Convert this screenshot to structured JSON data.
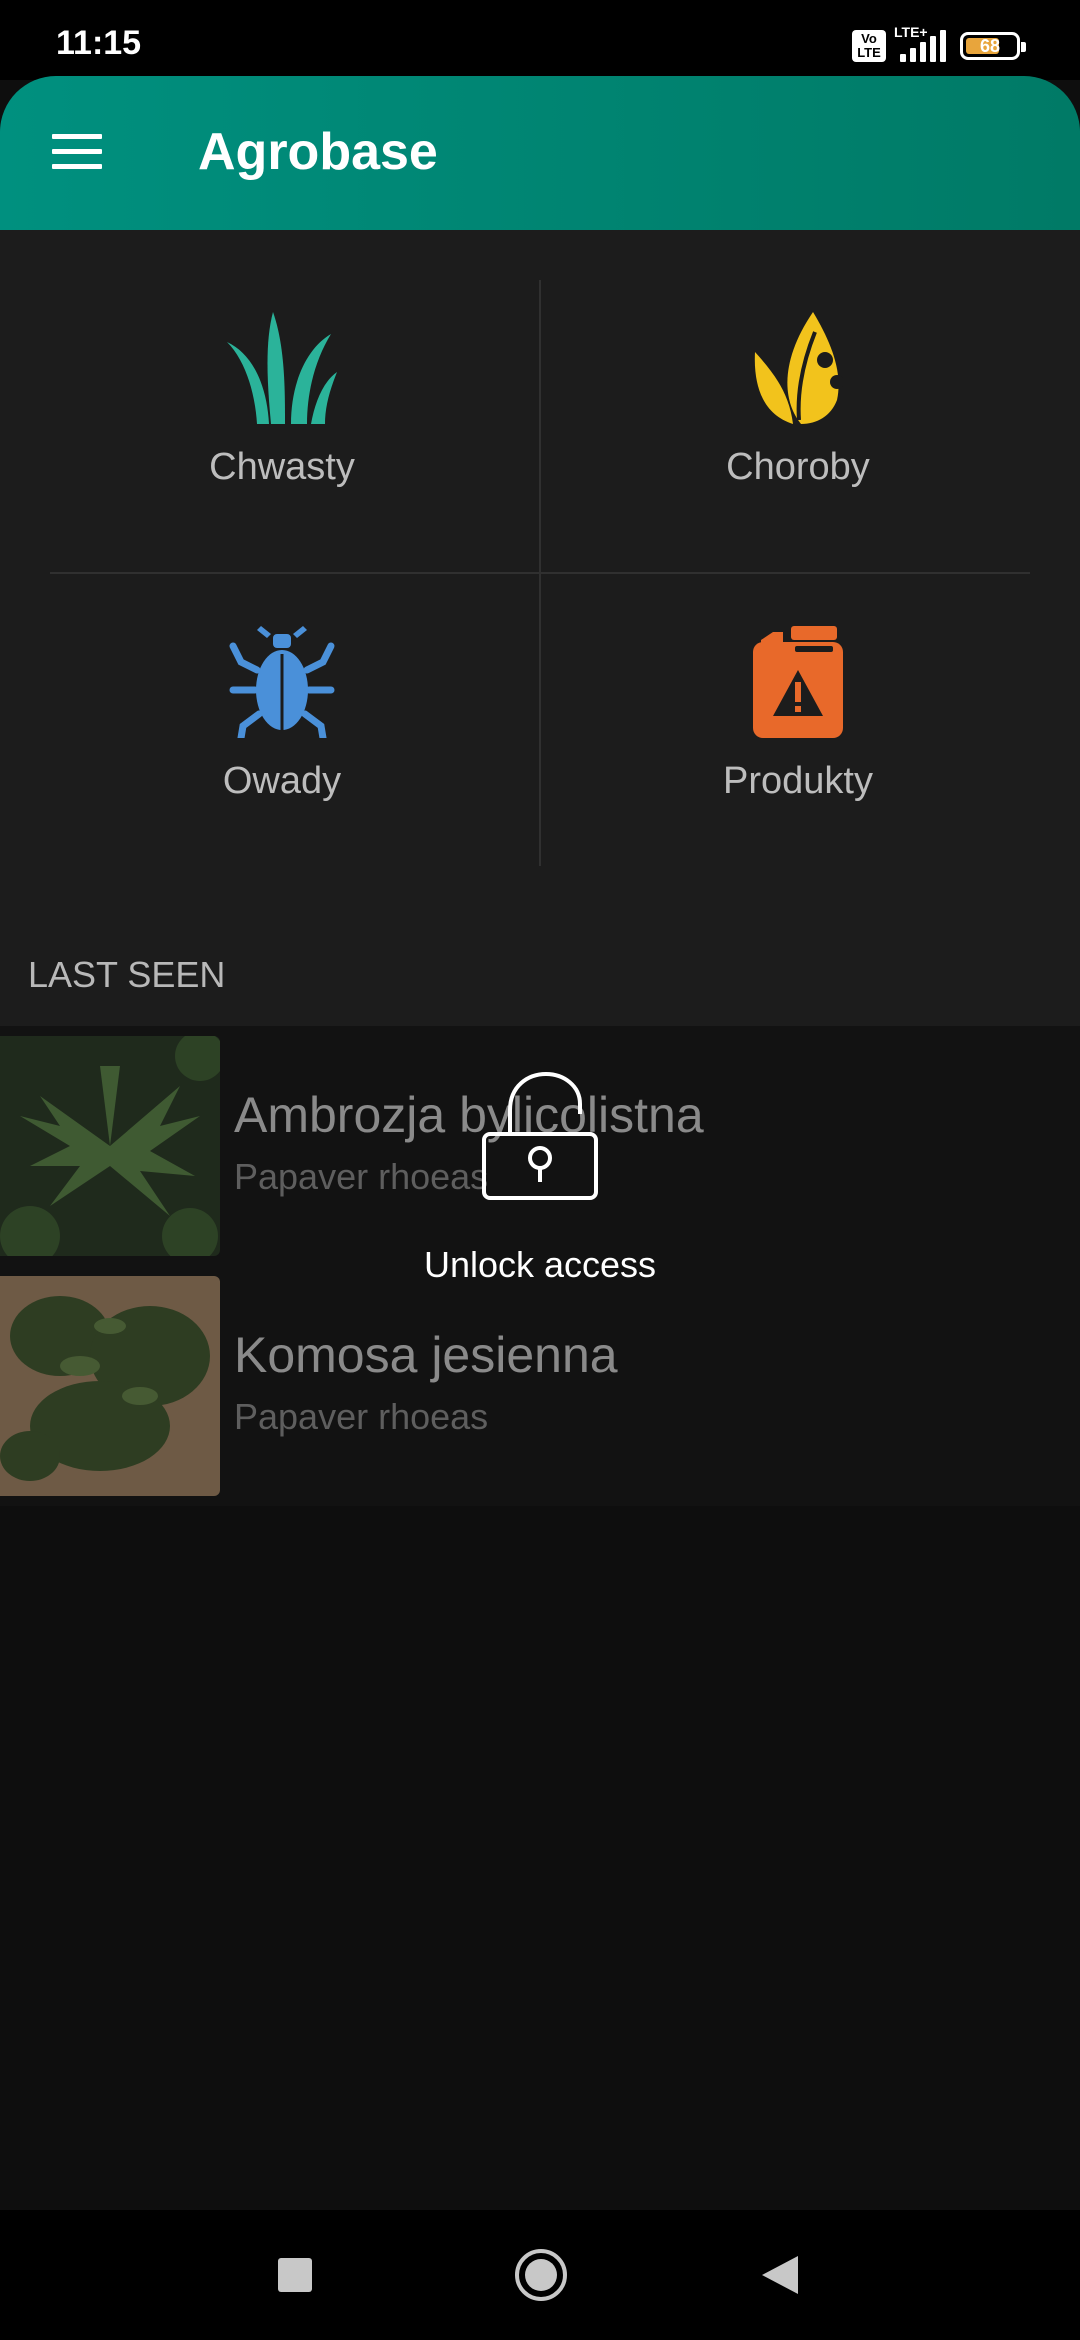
{
  "status_bar": {
    "time": "11:15",
    "volte_line1": "Vo",
    "volte_line2": "LTE",
    "network": "LTE+",
    "battery": "68",
    "battery_level": 0.68,
    "battery_color": "#e8a53c"
  },
  "app_bar": {
    "title": "Agrobase",
    "menu_icon": "hamburger-menu-icon",
    "gradient": [
      "#00907f",
      "#007a66"
    ]
  },
  "categories": [
    {
      "label": "Chwasty",
      "icon": "weed-grass-icon",
      "color": "#2bb39a"
    },
    {
      "label": "Choroby",
      "icon": "diseased-leaf-icon",
      "color": "#f2c31c"
    },
    {
      "label": "Owady",
      "icon": "beetle-icon",
      "color": "#4a90d9"
    },
    {
      "label": "Produkty",
      "icon": "chemical-canister-icon",
      "color": "#e8692a"
    }
  ],
  "last_seen": {
    "heading": "LAST SEEN",
    "items": [
      {
        "title": "Ambrozja bylicolistna",
        "subtitle": "Papaver rhoeas"
      },
      {
        "title": "Komosa jesienna",
        "subtitle": "Papaver rhoeas"
      }
    ]
  },
  "lock": {
    "icon": "unlocked-padlock-icon",
    "label": "Unlock access"
  },
  "nav_bar": {
    "recents_icon": "square-recents-icon",
    "home_icon": "circle-home-icon",
    "back_icon": "triangle-back-icon"
  }
}
